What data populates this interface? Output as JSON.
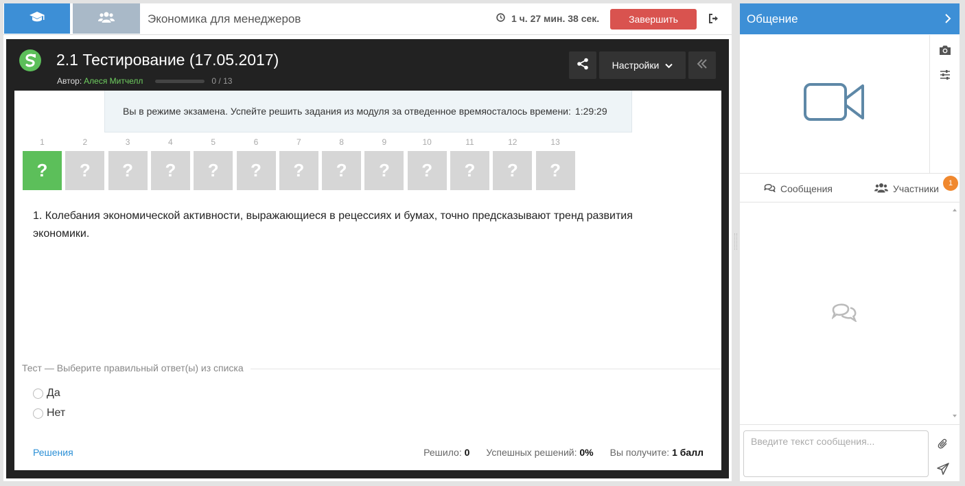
{
  "header": {
    "course_title": "Экономика для менеджеров",
    "timer": "1 ч. 27 мин. 38 сек.",
    "finish_label": "Завершить"
  },
  "lesson": {
    "title": "2.1 Тестирование (17.05.2017)",
    "author_label": "Автор:",
    "author_name": "Алеся Митчелл",
    "progress_text": "0 / 13",
    "progress_fraction": 0.0,
    "settings_label": "Настройки"
  },
  "exam_banner": {
    "text": "Вы в режиме экзамена. Успейте решить задания из модуля за отведенное времяосталось времени:",
    "time": "1:29:29"
  },
  "questions": [
    {
      "num": "1",
      "mark": "?",
      "active": true
    },
    {
      "num": "2",
      "mark": "?",
      "active": false
    },
    {
      "num": "3",
      "mark": "?",
      "active": false
    },
    {
      "num": "4",
      "mark": "?",
      "active": false
    },
    {
      "num": "5",
      "mark": "?",
      "active": false
    },
    {
      "num": "6",
      "mark": "?",
      "active": false
    },
    {
      "num": "7",
      "mark": "?",
      "active": false
    },
    {
      "num": "8",
      "mark": "?",
      "active": false
    },
    {
      "num": "9",
      "mark": "?",
      "active": false
    },
    {
      "num": "10",
      "mark": "?",
      "active": false
    },
    {
      "num": "11",
      "mark": "?",
      "active": false
    },
    {
      "num": "12",
      "mark": "?",
      "active": false
    },
    {
      "num": "13",
      "mark": "?",
      "active": false
    }
  ],
  "question_text": "1. Колебания экономической активности, выражающиеся в рецессиях и бумах, точно предсказывают тренд развития экономики.",
  "answer": {
    "header": "Тест — Выберите правильный ответ(ы) из списка",
    "options": [
      "Да",
      "Нет"
    ]
  },
  "footer": {
    "solutions_link": "Решения",
    "solved_label": "Решило:",
    "solved_value": "0",
    "success_label": "Успешных решений:",
    "success_value": "0%",
    "reward_label": "Вы получите:",
    "reward_value": "1 балл"
  },
  "sidebar": {
    "title": "Общение",
    "messages_tab": "Сообщения",
    "participants_tab": "Участники",
    "participants_badge": "1",
    "input_placeholder": "Введите текст сообщения..."
  },
  "colors": {
    "accent": "#3d8fd6",
    "finish": "#d9534f",
    "active_question": "#5cbf5a",
    "inactive_question": "#d6d6d6",
    "badge": "#f0882e"
  },
  "icons": [
    "graduation-cap-icon",
    "group-icon",
    "clock-icon",
    "logout-icon",
    "logo-icon",
    "share-icon",
    "chevron-down-icon",
    "double-chevron-left-icon",
    "chevron-right-icon",
    "camera-icon",
    "sliders-icon",
    "video-camera-icon",
    "comments-icon",
    "users-icon",
    "paperclip-icon",
    "send-icon"
  ]
}
